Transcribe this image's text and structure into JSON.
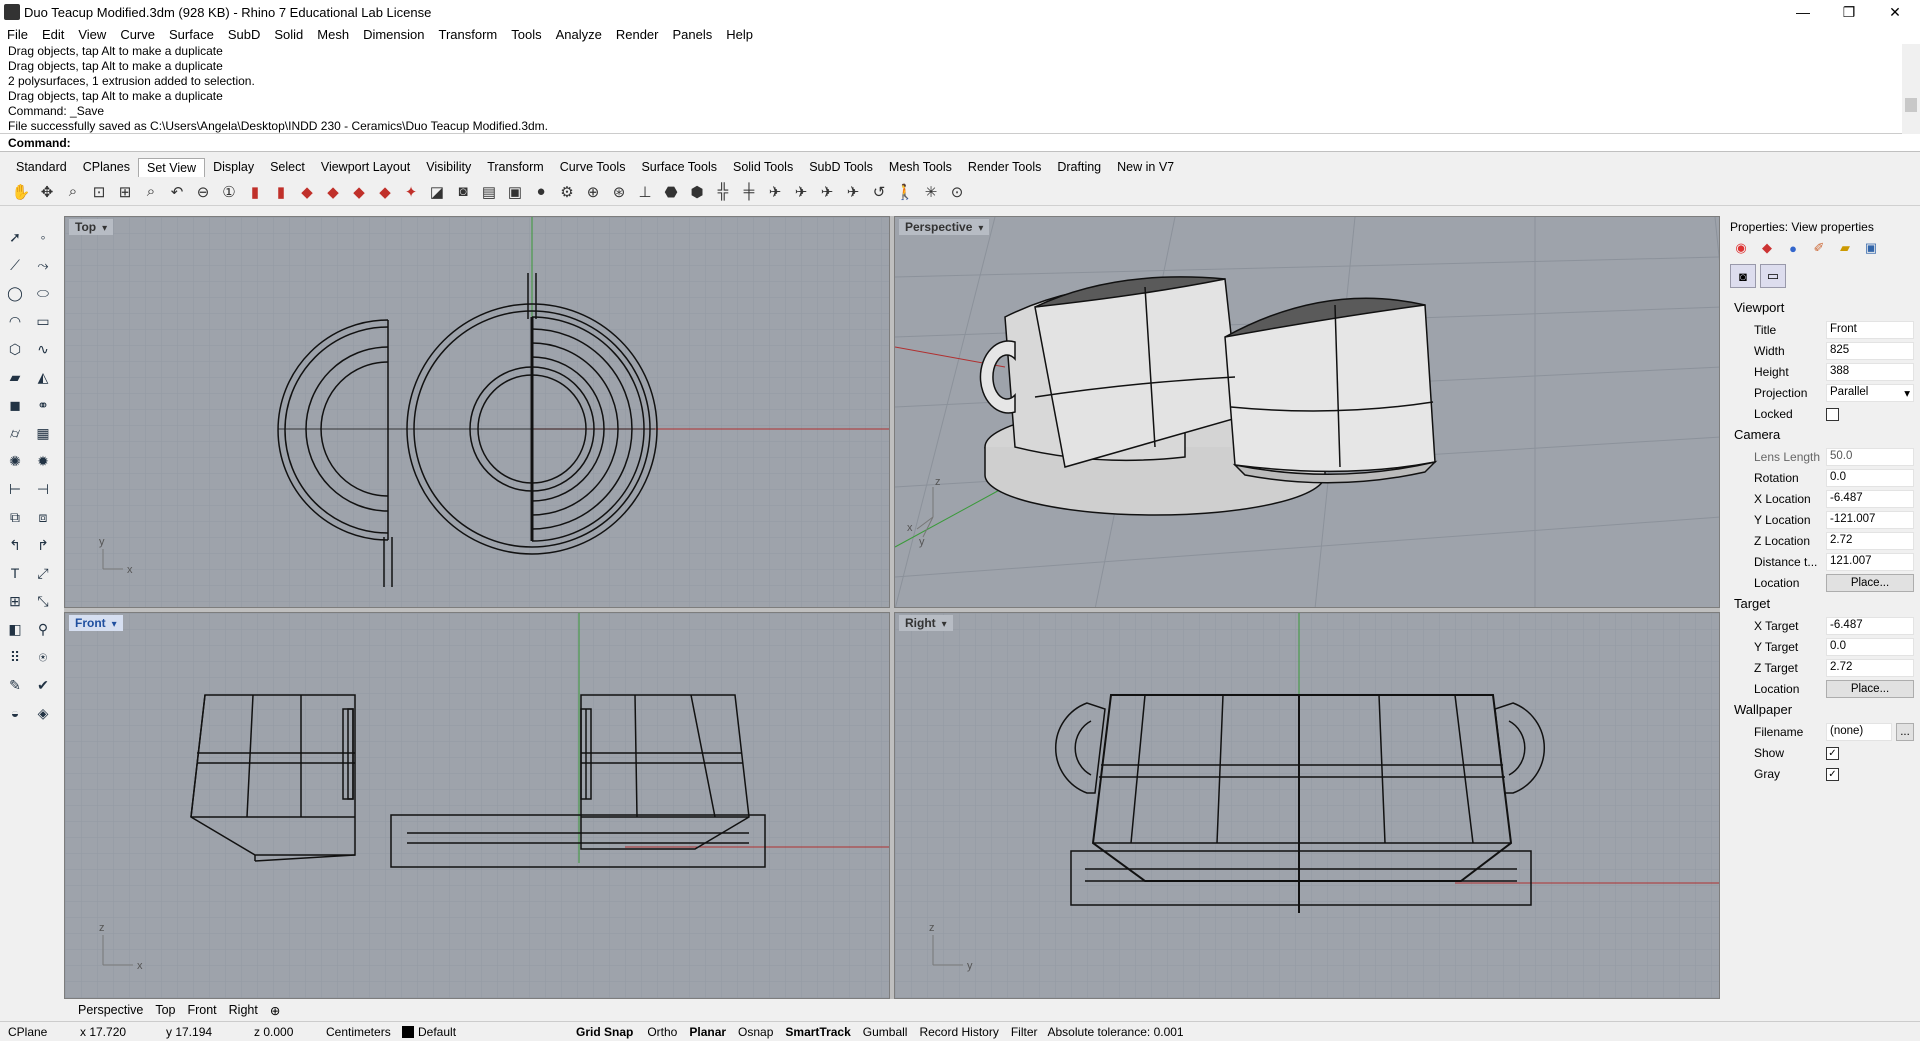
{
  "title_bar": {
    "title": "Duo Teacup Modified.3dm (928 KB) - Rhino 7 Educational Lab License",
    "minimize": "—",
    "maximize": "❐",
    "close": "✕"
  },
  "menu": [
    "File",
    "Edit",
    "View",
    "Curve",
    "Surface",
    "SubD",
    "Solid",
    "Mesh",
    "Dimension",
    "Transform",
    "Tools",
    "Analyze",
    "Render",
    "Panels",
    "Help"
  ],
  "history": [
    "Drag objects, tap Alt to make a duplicate",
    "Drag objects, tap Alt to make a duplicate",
    "2 polysurfaces, 1 extrusion added to selection.",
    "Drag objects, tap Alt to make a duplicate",
    "Command: _Save",
    "File successfully saved as C:\\Users\\Angela\\Desktop\\INDD 230 - Ceramics\\Duo Teacup Modified.3dm."
  ],
  "command": {
    "label": "Command:",
    "value": ""
  },
  "toolbar_tabs": [
    "Standard",
    "CPlanes",
    "Set View",
    "Display",
    "Select",
    "Viewport Layout",
    "Visibility",
    "Transform",
    "Curve Tools",
    "Surface Tools",
    "Solid Tools",
    "SubD Tools",
    "Mesh Tools",
    "Render Tools",
    "Drafting",
    "New in V7"
  ],
  "active_tab": "Set View",
  "viewports": {
    "top": "Top",
    "perspective": "Perspective",
    "front": "Front",
    "right": "Right"
  },
  "axis_labels": {
    "x": "x",
    "y": "y",
    "z": "z"
  },
  "properties": {
    "header": "Properties: View properties",
    "viewport_section": "Viewport",
    "title_label": "Title",
    "title_value": "Front",
    "width_label": "Width",
    "width_value": "825",
    "height_label": "Height",
    "height_value": "388",
    "projection_label": "Projection",
    "projection_value": "Parallel",
    "locked_label": "Locked",
    "camera_section": "Camera",
    "lens_label": "Lens Length",
    "lens_value": "50.0",
    "rotation_label": "Rotation",
    "rotation_value": "0.0",
    "xloc_label": "X Location",
    "xloc_value": "-6.487",
    "yloc_label": "Y Location",
    "yloc_value": "-121.007",
    "zloc_label": "Z Location",
    "zloc_value": "2.72",
    "dist_label": "Distance t...",
    "dist_value": "121.007",
    "location_label": "Location",
    "place_button": "Place...",
    "target_section": "Target",
    "xt_label": "X Target",
    "xt_value": "-6.487",
    "yt_label": "Y Target",
    "yt_value": "0.0",
    "zt_label": "Z Target",
    "zt_value": "2.72",
    "tloc_label": "Location",
    "wallpaper_section": "Wallpaper",
    "filename_label": "Filename",
    "filename_value": "(none)",
    "filename_btn": "...",
    "show_label": "Show",
    "gray_label": "Gray",
    "check": "✓"
  },
  "viewport_tabs": [
    "Perspective",
    "Top",
    "Front",
    "Right"
  ],
  "viewport_tab_add": "⊕",
  "status": {
    "cplane": "CPlane",
    "x": "x 17.720",
    "y": "y 17.194",
    "z": "z 0.000",
    "units": "Centimeters",
    "layer": "Default",
    "grid_snap": "Grid Snap",
    "ortho": "Ortho",
    "planar": "Planar",
    "osnap": "Osnap",
    "smarttrack": "SmartTrack",
    "gumball": "Gumball",
    "record_history": "Record History",
    "filter": "Filter",
    "tolerance": "Absolute tolerance: 0.001"
  }
}
